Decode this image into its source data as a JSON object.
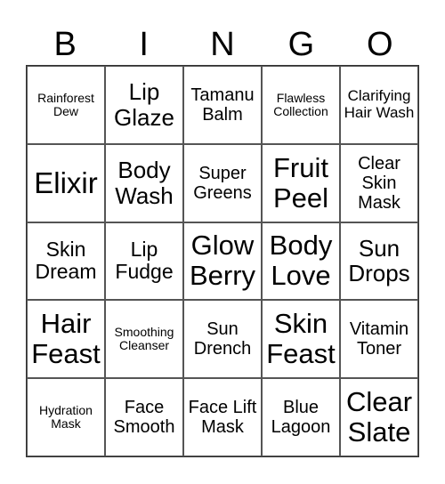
{
  "header": [
    "B",
    "I",
    "N",
    "G",
    "O"
  ],
  "cells": [
    {
      "text": "Rainforest Dew",
      "size": "s1"
    },
    {
      "text": "Lip Glaze",
      "size": "s5"
    },
    {
      "text": "Tamanu Balm",
      "size": "s3"
    },
    {
      "text": "Flawless Collection",
      "size": "s1"
    },
    {
      "text": "Clarifying Hair Wash",
      "size": "s2"
    },
    {
      "text": "Elixir",
      "size": "s7"
    },
    {
      "text": "Body Wash",
      "size": "s5"
    },
    {
      "text": "Super Greens",
      "size": "s3"
    },
    {
      "text": "Fruit Peel",
      "size": "s6"
    },
    {
      "text": "Clear Skin Mask",
      "size": "s3"
    },
    {
      "text": "Skin Dream",
      "size": "s4"
    },
    {
      "text": "Lip Fudge",
      "size": "s4"
    },
    {
      "text": "Glow Berry",
      "size": "s6"
    },
    {
      "text": "Body Love",
      "size": "s6"
    },
    {
      "text": "Sun Drops",
      "size": "s5"
    },
    {
      "text": "Hair Feast",
      "size": "s6"
    },
    {
      "text": "Smoothing Cleanser",
      "size": "s1"
    },
    {
      "text": "Sun Drench",
      "size": "s3"
    },
    {
      "text": "Skin Feast",
      "size": "s6"
    },
    {
      "text": "Vitamin Toner",
      "size": "s3"
    },
    {
      "text": "Hydration Mask",
      "size": "s1"
    },
    {
      "text": "Face Smooth",
      "size": "s3"
    },
    {
      "text": "Face Lift Mask",
      "size": "s3"
    },
    {
      "text": "Blue Lagoon",
      "size": "s3"
    },
    {
      "text": "Clear Slate",
      "size": "s6"
    }
  ]
}
